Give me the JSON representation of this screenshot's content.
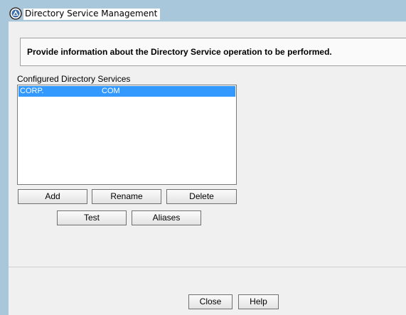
{
  "window": {
    "title": "Directory Service Management"
  },
  "info": {
    "text": "Provide information about the Directory Service operation to be performed."
  },
  "services": {
    "label": "Configured Directory Services",
    "items": [
      {
        "name": "CORP.",
        "suffix": "COM"
      }
    ]
  },
  "buttons": {
    "add": "Add",
    "rename": "Rename",
    "delete": "Delete",
    "test": "Test",
    "aliases": "Aliases",
    "close": "Close",
    "help": "Help"
  },
  "colors": {
    "selection": "#3399ff",
    "titlebar": "#a9c7db",
    "dialog_bg": "#f0f0f0"
  }
}
